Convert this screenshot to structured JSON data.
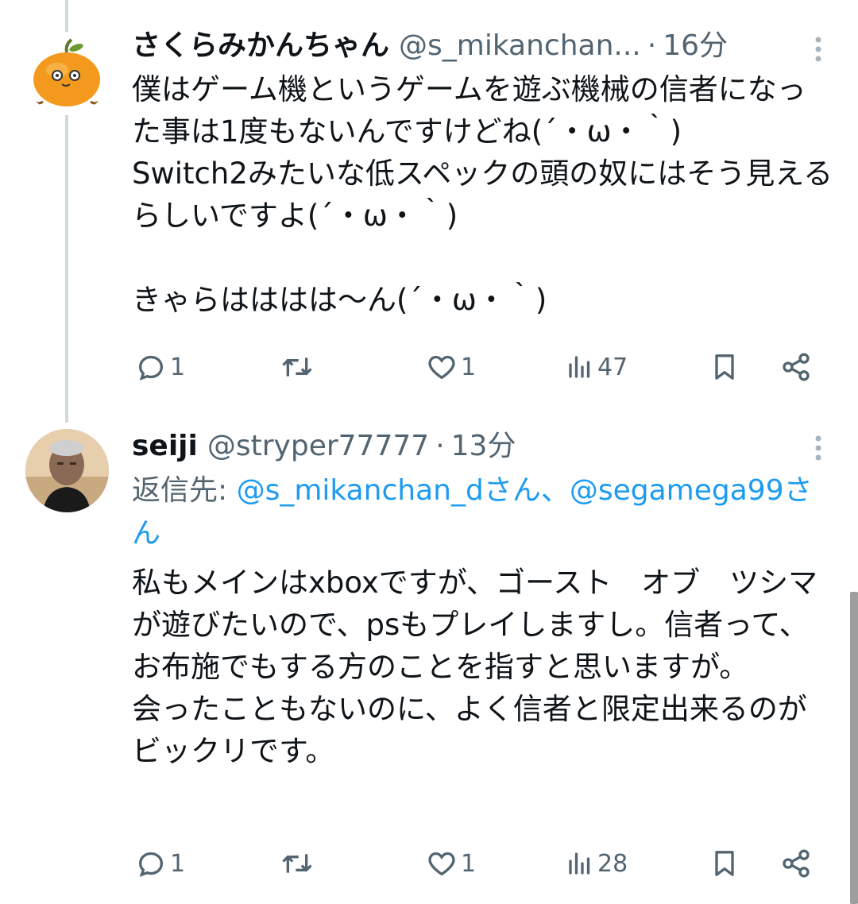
{
  "tweets": [
    {
      "name": "さくらみかんちゃん",
      "handle": "@s_mikanchan...",
      "dot": "·",
      "time": "16分",
      "body": "僕はゲーム機というゲームを遊ぶ機械の信者になった事は1度もないんですけどね(´・ω・｀)\nSwitch2みたいな低スペックの頭の奴にはそう見えるらしいですよ(´・ω・｀)\n\nきゃらはははは〜ん(´・ω・｀)",
      "replies": "1",
      "retweets": "",
      "likes": "1",
      "views": "47"
    },
    {
      "name": "seiji",
      "handle": "@stryper77777",
      "dot": "·",
      "time": "13分",
      "reply_prefix": "返信先: ",
      "reply_user1": "@s_mikanchan_dさん",
      "reply_sep": "、",
      "reply_user2": "@segamega99さん",
      "body": "私もメインはxboxですが、ゴースト　オブ　ツシマ　が遊びたいので、psもプレイしますし。信者って、お布施でもする方のことを指すと思いますが。\n会ったこともないのに、よく信者と限定出来るのがビックリです。",
      "replies": "1",
      "retweets": "",
      "likes": "1",
      "views": "28"
    }
  ],
  "icons": {
    "reply": "reply-icon",
    "retweet": "retweet-icon",
    "like": "heart-icon",
    "views": "views-icon",
    "bookmark": "bookmark-icon",
    "share": "share-icon",
    "more": "more-icon"
  },
  "colors": {
    "text": "#0f1419",
    "secondary": "#536471",
    "link": "#1d9bf0",
    "thread_line": "#cfd9de",
    "avatar_orange": "#f39a1e"
  }
}
